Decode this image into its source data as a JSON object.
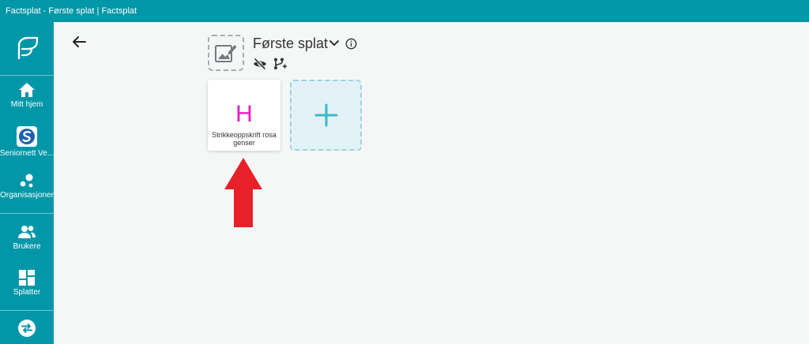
{
  "window": {
    "title": "Factsplat - Første splat | Factsplat"
  },
  "sidebar": {
    "logo_icon": "factsplat-logo-icon",
    "items": [
      {
        "label": "Mitt hjem",
        "icon": "home-icon"
      },
      {
        "label": "Seniornett Ve...",
        "icon": "organization-logo-icon"
      },
      {
        "label": "Organisasjoner",
        "icon": "organizations-icon"
      },
      {
        "label": "Brukere",
        "icon": "users-icon"
      },
      {
        "label": "Splatter",
        "icon": "dashboard-icon"
      },
      {
        "label": "",
        "icon": "swap-icon"
      }
    ]
  },
  "header": {
    "back_icon": "arrow-left-icon",
    "title": "Første splat",
    "image_icon": "image-edit-icon",
    "chevron_icon": "chevron-down-icon",
    "info_icon": "info-icon",
    "hidden_icon": "eye-off-icon",
    "share_icon": "share-tree-icon"
  },
  "cards": [
    {
      "letter": "H",
      "name": "Strikkeoppskrift rosa genser",
      "letter_color": "#e61cc4"
    }
  ],
  "add_card": {
    "icon": "plus-icon"
  },
  "colors": {
    "accent": "#0297a8",
    "plus": "#3fb8c6",
    "annotation_arrow": "#e8202a"
  }
}
